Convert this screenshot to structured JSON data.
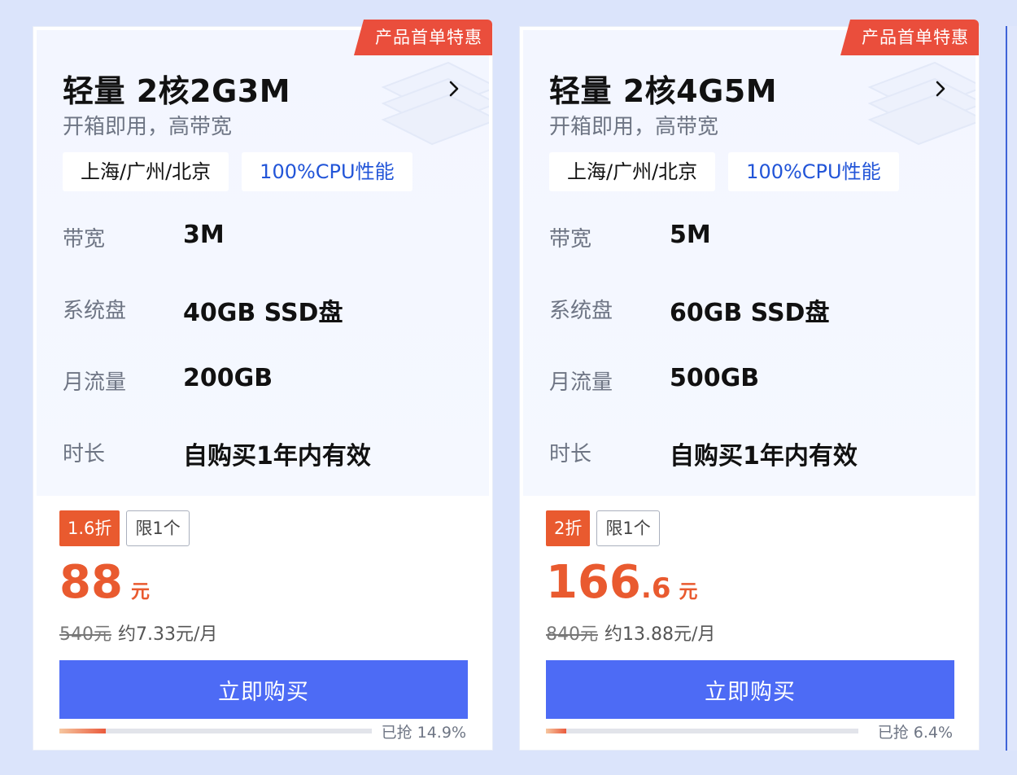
{
  "cards": [
    {
      "promo_badge": "产品首单特惠",
      "title": "轻量 2核2G3M",
      "subtitle": "开箱即用，高带宽",
      "tags": {
        "region": "上海/广州/北京",
        "cpu": "100%CPU性能"
      },
      "specs": [
        {
          "label": "带宽",
          "value": "3M"
        },
        {
          "label": "系统盘",
          "value": "40GB SSD盘"
        },
        {
          "label": "月流量",
          "value": "200GB"
        },
        {
          "label": "时长",
          "value": "自购买1年内有效"
        }
      ],
      "discount": "1.6折",
      "limit": "限1个",
      "price": {
        "integer": "88",
        "decimal": "",
        "unit": "元"
      },
      "original_price": "540元",
      "monthly": "约7.33元/月",
      "buy_label": "立即购买",
      "sold_text": "已抢 14.9%",
      "sold_percent": 14.9
    },
    {
      "promo_badge": "产品首单特惠",
      "title": "轻量 2核4G5M",
      "subtitle": "开箱即用，高带宽",
      "tags": {
        "region": "上海/广州/北京",
        "cpu": "100%CPU性能"
      },
      "specs": [
        {
          "label": "带宽",
          "value": "5M"
        },
        {
          "label": "系统盘",
          "value": "60GB SSD盘"
        },
        {
          "label": "月流量",
          "value": "500GB"
        },
        {
          "label": "时长",
          "value": "自购买1年内有效"
        }
      ],
      "discount": "2折",
      "limit": "限1个",
      "price": {
        "integer": "166",
        "decimal": ".6",
        "unit": "元"
      },
      "original_price": "840元",
      "monthly": "约13.88元/月",
      "buy_label": "立即购买",
      "sold_text": "已抢 6.4%",
      "sold_percent": 6.4
    }
  ],
  "colors": {
    "accent": "#4d6bf5",
    "discount": "#e95a2f",
    "promo": "#ea4e3c",
    "cpu_tag": "#2255d8"
  },
  "icons": {
    "title_arrow": "chevron-right-icon"
  }
}
